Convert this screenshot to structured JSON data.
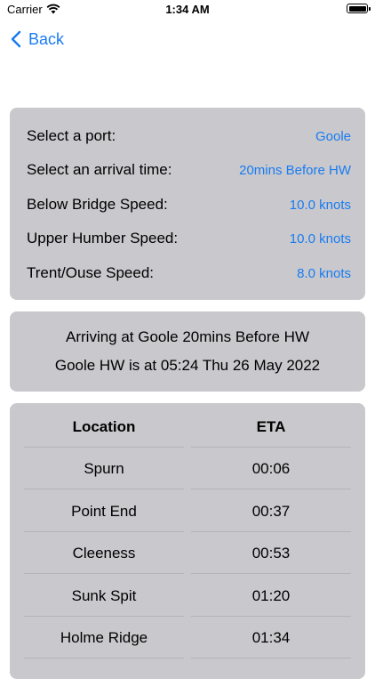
{
  "status_bar": {
    "carrier": "Carrier",
    "time": "1:34 AM"
  },
  "nav": {
    "back_label": "Back"
  },
  "settings": {
    "rows": [
      {
        "label": "Select a port:",
        "value": "Goole"
      },
      {
        "label": "Select an arrival time:",
        "value": "20mins Before HW"
      },
      {
        "label": "Below Bridge Speed:",
        "value": "10.0 knots"
      },
      {
        "label": "Upper Humber Speed:",
        "value": "10.0 knots"
      },
      {
        "label": "Trent/Ouse Speed:",
        "value": "8.0 knots"
      }
    ]
  },
  "info": {
    "line1": "Arriving at Goole 20mins Before HW",
    "line2": "Goole HW is at 05:24 Thu 26 May 2022"
  },
  "table": {
    "headers": [
      "Location",
      "ETA"
    ],
    "rows": [
      [
        "Spurn",
        "00:06"
      ],
      [
        "Point End",
        "00:37"
      ],
      [
        "Cleeness",
        "00:53"
      ],
      [
        "Sunk Spit",
        "01:20"
      ],
      [
        "Holme Ridge",
        "01:34"
      ]
    ]
  },
  "colors": {
    "accent": "#1a7cf0",
    "card": "#c8c8cd"
  }
}
